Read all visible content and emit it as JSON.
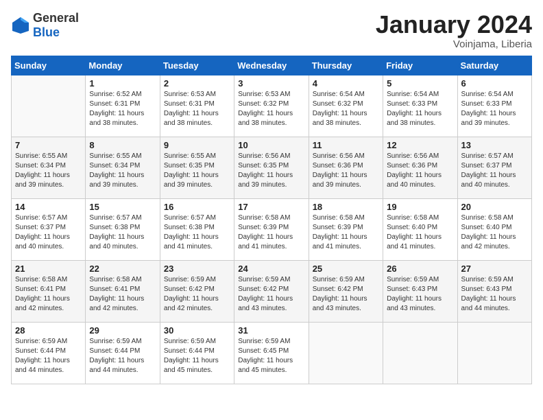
{
  "header": {
    "logo_general": "General",
    "logo_blue": "Blue",
    "month_title": "January 2024",
    "subtitle": "Voinjama, Liberia"
  },
  "days_of_week": [
    "Sunday",
    "Monday",
    "Tuesday",
    "Wednesday",
    "Thursday",
    "Friday",
    "Saturday"
  ],
  "weeks": [
    [
      {
        "day": "",
        "sunrise": "",
        "sunset": "",
        "daylight": ""
      },
      {
        "day": "1",
        "sunrise": "Sunrise: 6:52 AM",
        "sunset": "Sunset: 6:31 PM",
        "daylight": "Daylight: 11 hours and 38 minutes."
      },
      {
        "day": "2",
        "sunrise": "Sunrise: 6:53 AM",
        "sunset": "Sunset: 6:31 PM",
        "daylight": "Daylight: 11 hours and 38 minutes."
      },
      {
        "day": "3",
        "sunrise": "Sunrise: 6:53 AM",
        "sunset": "Sunset: 6:32 PM",
        "daylight": "Daylight: 11 hours and 38 minutes."
      },
      {
        "day": "4",
        "sunrise": "Sunrise: 6:54 AM",
        "sunset": "Sunset: 6:32 PM",
        "daylight": "Daylight: 11 hours and 38 minutes."
      },
      {
        "day": "5",
        "sunrise": "Sunrise: 6:54 AM",
        "sunset": "Sunset: 6:33 PM",
        "daylight": "Daylight: 11 hours and 38 minutes."
      },
      {
        "day": "6",
        "sunrise": "Sunrise: 6:54 AM",
        "sunset": "Sunset: 6:33 PM",
        "daylight": "Daylight: 11 hours and 39 minutes."
      }
    ],
    [
      {
        "day": "7",
        "sunrise": "Sunrise: 6:55 AM",
        "sunset": "Sunset: 6:34 PM",
        "daylight": "Daylight: 11 hours and 39 minutes."
      },
      {
        "day": "8",
        "sunrise": "Sunrise: 6:55 AM",
        "sunset": "Sunset: 6:34 PM",
        "daylight": "Daylight: 11 hours and 39 minutes."
      },
      {
        "day": "9",
        "sunrise": "Sunrise: 6:55 AM",
        "sunset": "Sunset: 6:35 PM",
        "daylight": "Daylight: 11 hours and 39 minutes."
      },
      {
        "day": "10",
        "sunrise": "Sunrise: 6:56 AM",
        "sunset": "Sunset: 6:35 PM",
        "daylight": "Daylight: 11 hours and 39 minutes."
      },
      {
        "day": "11",
        "sunrise": "Sunrise: 6:56 AM",
        "sunset": "Sunset: 6:36 PM",
        "daylight": "Daylight: 11 hours and 39 minutes."
      },
      {
        "day": "12",
        "sunrise": "Sunrise: 6:56 AM",
        "sunset": "Sunset: 6:36 PM",
        "daylight": "Daylight: 11 hours and 40 minutes."
      },
      {
        "day": "13",
        "sunrise": "Sunrise: 6:57 AM",
        "sunset": "Sunset: 6:37 PM",
        "daylight": "Daylight: 11 hours and 40 minutes."
      }
    ],
    [
      {
        "day": "14",
        "sunrise": "Sunrise: 6:57 AM",
        "sunset": "Sunset: 6:37 PM",
        "daylight": "Daylight: 11 hours and 40 minutes."
      },
      {
        "day": "15",
        "sunrise": "Sunrise: 6:57 AM",
        "sunset": "Sunset: 6:38 PM",
        "daylight": "Daylight: 11 hours and 40 minutes."
      },
      {
        "day": "16",
        "sunrise": "Sunrise: 6:57 AM",
        "sunset": "Sunset: 6:38 PM",
        "daylight": "Daylight: 11 hours and 41 minutes."
      },
      {
        "day": "17",
        "sunrise": "Sunrise: 6:58 AM",
        "sunset": "Sunset: 6:39 PM",
        "daylight": "Daylight: 11 hours and 41 minutes."
      },
      {
        "day": "18",
        "sunrise": "Sunrise: 6:58 AM",
        "sunset": "Sunset: 6:39 PM",
        "daylight": "Daylight: 11 hours and 41 minutes."
      },
      {
        "day": "19",
        "sunrise": "Sunrise: 6:58 AM",
        "sunset": "Sunset: 6:40 PM",
        "daylight": "Daylight: 11 hours and 41 minutes."
      },
      {
        "day": "20",
        "sunrise": "Sunrise: 6:58 AM",
        "sunset": "Sunset: 6:40 PM",
        "daylight": "Daylight: 11 hours and 42 minutes."
      }
    ],
    [
      {
        "day": "21",
        "sunrise": "Sunrise: 6:58 AM",
        "sunset": "Sunset: 6:41 PM",
        "daylight": "Daylight: 11 hours and 42 minutes."
      },
      {
        "day": "22",
        "sunrise": "Sunrise: 6:58 AM",
        "sunset": "Sunset: 6:41 PM",
        "daylight": "Daylight: 11 hours and 42 minutes."
      },
      {
        "day": "23",
        "sunrise": "Sunrise: 6:59 AM",
        "sunset": "Sunset: 6:42 PM",
        "daylight": "Daylight: 11 hours and 42 minutes."
      },
      {
        "day": "24",
        "sunrise": "Sunrise: 6:59 AM",
        "sunset": "Sunset: 6:42 PM",
        "daylight": "Daylight: 11 hours and 43 minutes."
      },
      {
        "day": "25",
        "sunrise": "Sunrise: 6:59 AM",
        "sunset": "Sunset: 6:42 PM",
        "daylight": "Daylight: 11 hours and 43 minutes."
      },
      {
        "day": "26",
        "sunrise": "Sunrise: 6:59 AM",
        "sunset": "Sunset: 6:43 PM",
        "daylight": "Daylight: 11 hours and 43 minutes."
      },
      {
        "day": "27",
        "sunrise": "Sunrise: 6:59 AM",
        "sunset": "Sunset: 6:43 PM",
        "daylight": "Daylight: 11 hours and 44 minutes."
      }
    ],
    [
      {
        "day": "28",
        "sunrise": "Sunrise: 6:59 AM",
        "sunset": "Sunset: 6:44 PM",
        "daylight": "Daylight: 11 hours and 44 minutes."
      },
      {
        "day": "29",
        "sunrise": "Sunrise: 6:59 AM",
        "sunset": "Sunset: 6:44 PM",
        "daylight": "Daylight: 11 hours and 44 minutes."
      },
      {
        "day": "30",
        "sunrise": "Sunrise: 6:59 AM",
        "sunset": "Sunset: 6:44 PM",
        "daylight": "Daylight: 11 hours and 45 minutes."
      },
      {
        "day": "31",
        "sunrise": "Sunrise: 6:59 AM",
        "sunset": "Sunset: 6:45 PM",
        "daylight": "Daylight: 11 hours and 45 minutes."
      },
      {
        "day": "",
        "sunrise": "",
        "sunset": "",
        "daylight": ""
      },
      {
        "day": "",
        "sunrise": "",
        "sunset": "",
        "daylight": ""
      },
      {
        "day": "",
        "sunrise": "",
        "sunset": "",
        "daylight": ""
      }
    ]
  ]
}
